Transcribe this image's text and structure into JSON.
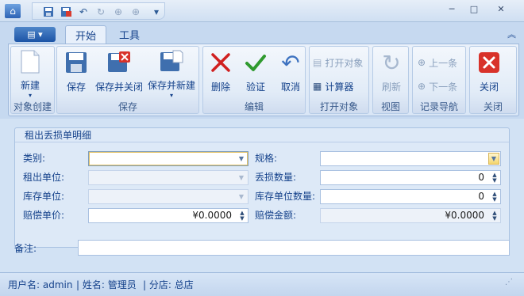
{
  "quick_access": {
    "dropdown": "▾"
  },
  "window": {
    "minimize": "─",
    "maximize": "□",
    "close": "✕"
  },
  "ribbon": {
    "app_menu": "▤ ▾",
    "tabs": [
      {
        "label": "开始",
        "active": true
      },
      {
        "label": "工具",
        "active": false
      }
    ],
    "collapse": "︽",
    "groups": {
      "create": {
        "label": "对象创建",
        "new_label": "新建"
      },
      "save": {
        "label": "保存",
        "save_label": "保存",
        "save_close_label": "保存并关闭",
        "save_new_label": "保存并新建"
      },
      "edit": {
        "label": "编辑",
        "delete_label": "删除",
        "validate_label": "验证",
        "cancel_label": "取消"
      },
      "open": {
        "label": "打开对象",
        "open_object_label": "打开对象",
        "calculator_label": "计算器"
      },
      "view": {
        "label": "视图",
        "refresh_label": "刷新"
      },
      "nav": {
        "label": "记录导航",
        "prev_label": "上一条",
        "next_label": "下一条"
      },
      "close": {
        "label": "关闭",
        "close_label": "关闭"
      }
    }
  },
  "form": {
    "section_title": "租出丢损单明细",
    "category": {
      "label": "类别:",
      "value": ""
    },
    "spec": {
      "label": "规格:",
      "value": ""
    },
    "rent_unit": {
      "label": "租出单位:",
      "value": ""
    },
    "loss_qty": {
      "label": "丢损数量:",
      "value": "0"
    },
    "stock_unit": {
      "label": "库存单位:",
      "value": ""
    },
    "stock_unit_qty": {
      "label": "库存单位数量:",
      "value": "0"
    },
    "comp_price": {
      "label": "赔偿单价:",
      "value": "¥0.0000"
    },
    "comp_amount": {
      "label": "赔偿金额:",
      "value": "¥0.0000"
    },
    "remark": {
      "label": "备注:",
      "value": ""
    }
  },
  "status": {
    "username": "用户名: admin",
    "name": "| 姓名: 管理员",
    "branch": "| 分店: 总店"
  },
  "colors": {
    "accent": "#15428b",
    "ribbon_bg": "#dfe9f5",
    "delete_red": "#d02020",
    "validate_green": "#2f9a2f"
  }
}
